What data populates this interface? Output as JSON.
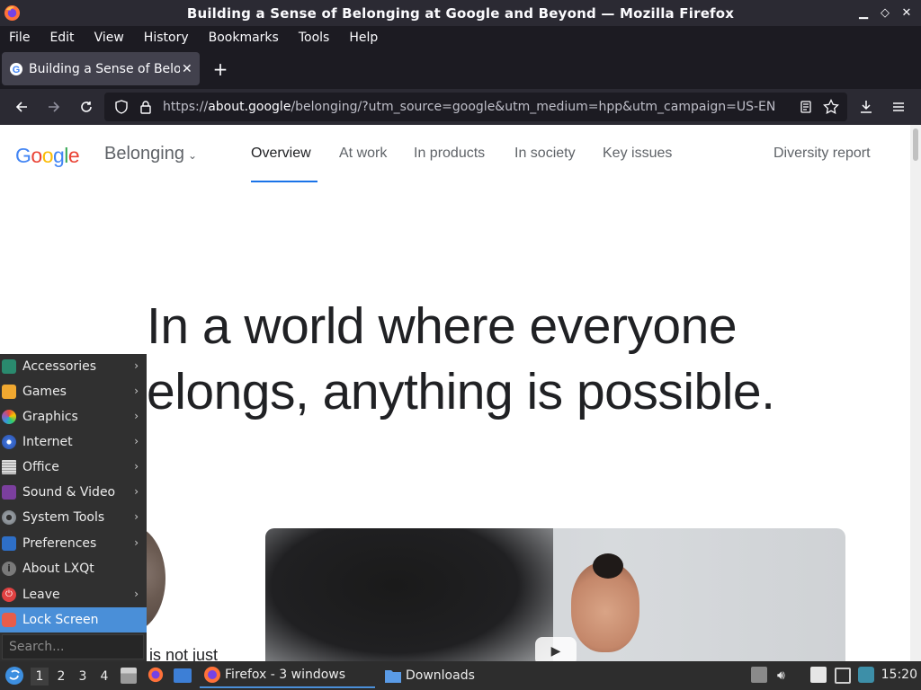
{
  "window": {
    "title": "Building a Sense of Belonging at Google and Beyond — Mozilla Firefox",
    "controls": [
      "minimize",
      "restore",
      "close"
    ]
  },
  "menubar": {
    "items": [
      {
        "label": "File"
      },
      {
        "label": "Edit"
      },
      {
        "label": "View"
      },
      {
        "label": "History"
      },
      {
        "label": "Bookmarks"
      },
      {
        "label": "Tools"
      },
      {
        "label": "Help"
      }
    ]
  },
  "tabs": [
    {
      "title": "Building a Sense of Belonging at Google and Beyond",
      "favicon": "google-icon"
    }
  ],
  "navbar": {
    "url_prefix": "https://",
    "url_domain": "about.google",
    "url_rest": "/belonging/?utm_source=google&utm_medium=hpp&utm_campaign=US-EN"
  },
  "page": {
    "logo": "Google",
    "section": "Belonging",
    "nav": [
      {
        "label": "Overview",
        "active": true
      },
      {
        "label": "At work",
        "active": false
      },
      {
        "label": "In products",
        "active": false
      },
      {
        "label": "In society",
        "active": false
      },
      {
        "label": "Key issues",
        "active": false
      }
    ],
    "diversity_link": "Diversity report",
    "hero_line1": "In a world where everyone",
    "hero_line2": "elongs, anything is possible.",
    "snippet": "is not just"
  },
  "start_menu": {
    "items": [
      {
        "label": "Accessories",
        "icon": "accessories-icon",
        "submenu": true
      },
      {
        "label": "Games",
        "icon": "games-icon",
        "submenu": true
      },
      {
        "label": "Graphics",
        "icon": "graphics-icon",
        "submenu": true
      },
      {
        "label": "Internet",
        "icon": "internet-icon",
        "submenu": true
      },
      {
        "label": "Office",
        "icon": "office-icon",
        "submenu": true
      },
      {
        "label": "Sound & Video",
        "icon": "sound-video-icon",
        "submenu": true
      },
      {
        "label": "System Tools",
        "icon": "system-tools-icon",
        "submenu": true
      },
      {
        "label": "Preferences",
        "icon": "preferences-icon",
        "submenu": true
      },
      {
        "label": "About LXQt",
        "icon": "about-icon",
        "submenu": false
      },
      {
        "label": "Leave",
        "icon": "leave-icon",
        "submenu": true
      },
      {
        "label": "Lock Screen",
        "icon": "lock-icon",
        "submenu": false,
        "highlighted": true
      }
    ],
    "search_placeholder": "Search..."
  },
  "taskbar": {
    "desktops": [
      "1",
      "2",
      "3",
      "4"
    ],
    "current_desktop": "1",
    "tasks": [
      {
        "label": "Firefox - 3 windows",
        "icon": "firefox-icon",
        "active": true
      },
      {
        "label": "Downloads",
        "icon": "folder-icon",
        "active": false
      }
    ],
    "clock": "15:20"
  }
}
